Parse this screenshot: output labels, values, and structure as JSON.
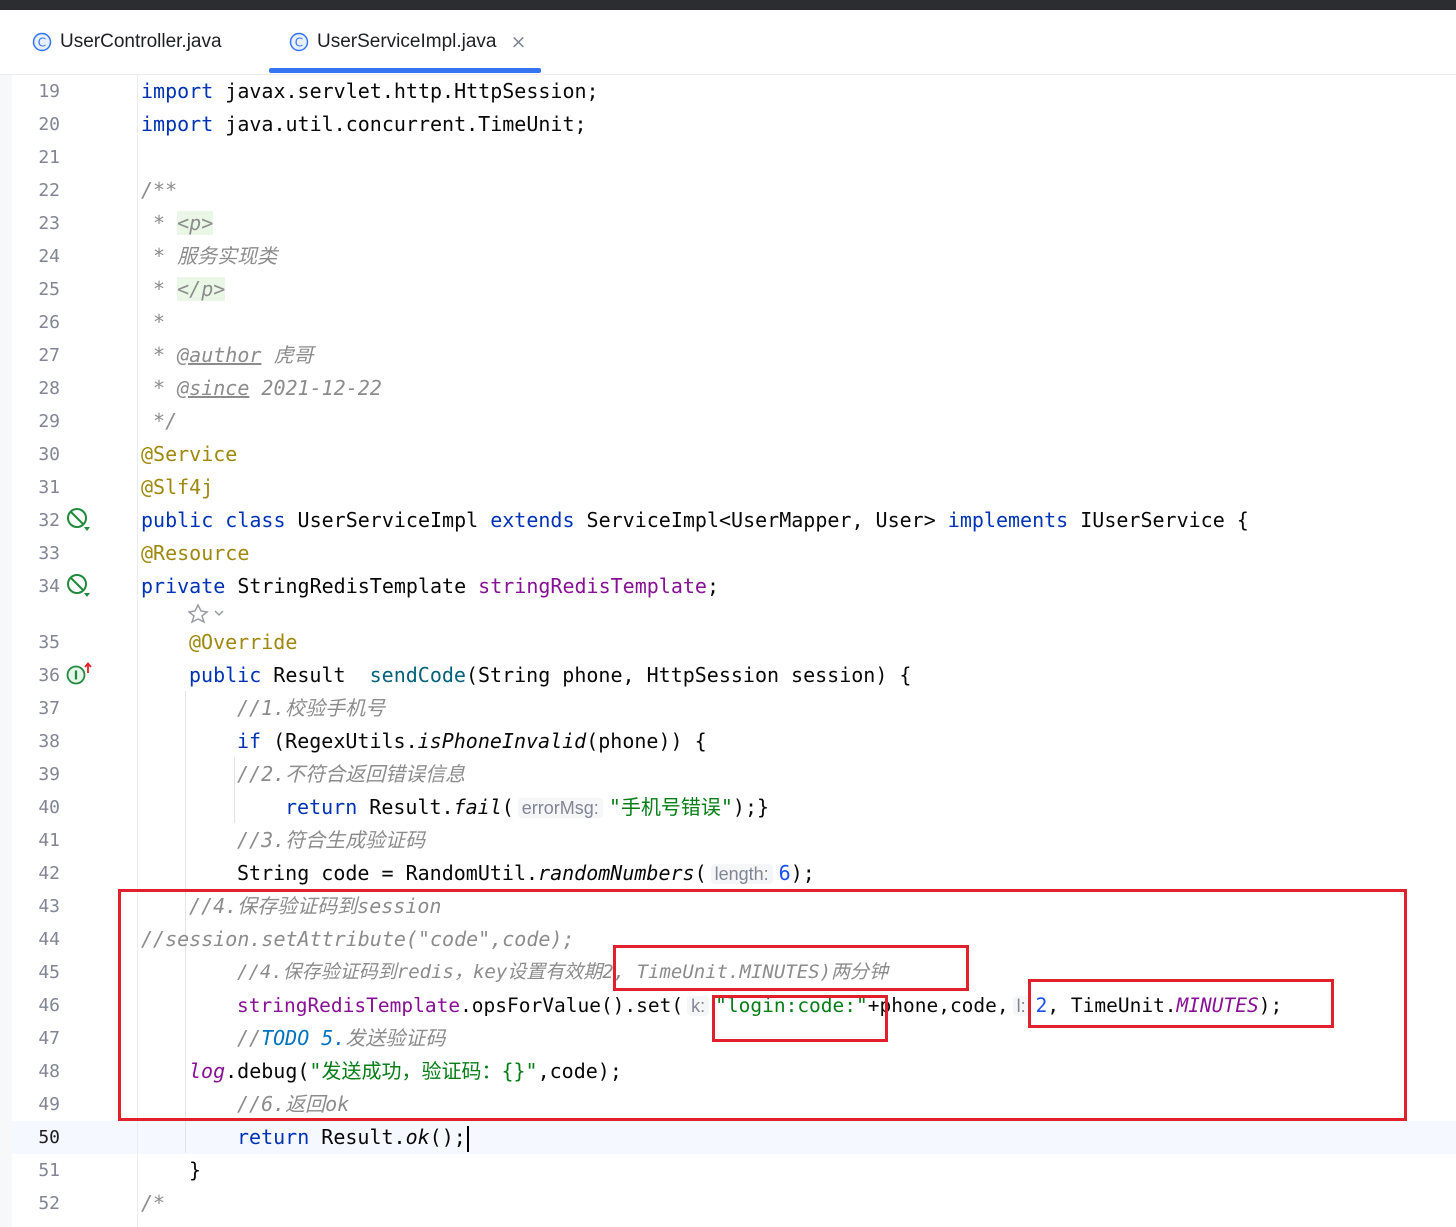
{
  "tabs": [
    {
      "label": "UserController.java",
      "active": false
    },
    {
      "label": "UserServiceImpl.java",
      "active": true,
      "close": "×"
    }
  ],
  "colors": {
    "keyword": "#0033b3",
    "annotation": "#9e880d",
    "comment": "#8c8c8c",
    "field": "#871094",
    "string": "#067d17",
    "number": "#1750eb",
    "method": "#00627a",
    "highlight_box": "#e0202a",
    "tab_underline": "#3574f0"
  },
  "icons": {
    "tab_file": "java-class-icon",
    "line_32": "no-usages-icon",
    "line_34": "no-usages-icon",
    "line_36": "implements-method-icon",
    "lens": "ai-lens-icon"
  },
  "editor": {
    "current_line": "50",
    "line_numbers": [
      "19",
      "20",
      "21",
      "22",
      "23",
      "24",
      "25",
      "26",
      "27",
      "28",
      "29",
      "30",
      "31",
      "32",
      "33",
      "34",
      "35",
      "36",
      "37",
      "38",
      "39",
      "40",
      "41",
      "42",
      "43",
      "44",
      "45",
      "46",
      "47",
      "48",
      "49",
      "50",
      "51",
      "52"
    ],
    "code": {
      "l19": {
        "kw": "import",
        "rest": " javax.servlet.http.HttpSession;"
      },
      "l20": {
        "kw": "import",
        "rest": " java.util.concurrent.TimeUnit;"
      },
      "l22": "/**",
      "l23": {
        "prefix": " * ",
        "tag": "<p>"
      },
      "l24": " * 服务实现类",
      "l25": {
        "prefix": " * ",
        "tag": "</p>"
      },
      "l26": " *",
      "l27": {
        "prefix": " * ",
        "tag": "@author",
        "value": " 虎哥"
      },
      "l28": {
        "prefix": " * ",
        "tag": "@since",
        "value": " 2021-12-22"
      },
      "l29": " */",
      "l30": "@Service",
      "l31": "@Slf4j",
      "l32": {
        "k1": "public class",
        "t1": " UserServiceImpl ",
        "k2": "extends",
        "t2": " ServiceImpl<UserMapper, User> ",
        "k3": "implements",
        "t3": " IUserService {"
      },
      "l33": "@Resource",
      "l34": {
        "kw": "private",
        "type": " StringRedisTemplate ",
        "field": "stringRedisTemplate",
        "end": ";"
      },
      "l35": "@Override",
      "l36": {
        "kw": "public",
        "type": " Result  ",
        "method": "sendCode",
        "params": "(String phone, HttpSession session) {"
      },
      "l37": "//1.校验手机号",
      "l38": {
        "kw": "if",
        "p1": " (RegexUtils.",
        "static": "isPhoneInvalid",
        "p2": "(phone)) {"
      },
      "l39": "//2.不符合返回错误信息",
      "l40": {
        "kw": "return",
        "p1": " Result.",
        "static": "fail",
        "p2": "(",
        "hint": "errorMsg:",
        "str": "\"手机号错误\"",
        "end": ");}"
      },
      "l41": "//3.符合生成验证码",
      "l42": {
        "p1": "String code = RandomUtil.",
        "static": "randomNumbers",
        "p2": "(",
        "hint": "length:",
        "num": "6",
        "end": ");"
      },
      "l43": "//4.保存验证码到session",
      "l44": "//session.setAttribute(\"code\",code);",
      "l45": "//4.保存验证码到redis，key设置有效期2, TimeUnit.MINUTES)两分钟",
      "l46": {
        "field": "stringRedisTemplate",
        "p1": ".opsForValue().set(",
        "hint1": "k:",
        "str": "\"login:code:\"",
        "p2": "+phone,code,",
        "hint2": "l:",
        "num": "2",
        "p3": ", TimeUnit.",
        "const": "MINUTES",
        "end": ");"
      },
      "l47": {
        "c1": "//",
        "todo": "TODO 5.",
        "c2": "发送验证码"
      },
      "l48": {
        "field": "log",
        "p1": ".debug(",
        "str": "\"发送成功，验证码：{}\"",
        "end": ",code);"
      },
      "l49": "//6.返回ok",
      "l50": {
        "kw": "return",
        "p1": " Result.",
        "static": "ok",
        "end": "();"
      },
      "l51": "}",
      "l52": "/*"
    }
  }
}
